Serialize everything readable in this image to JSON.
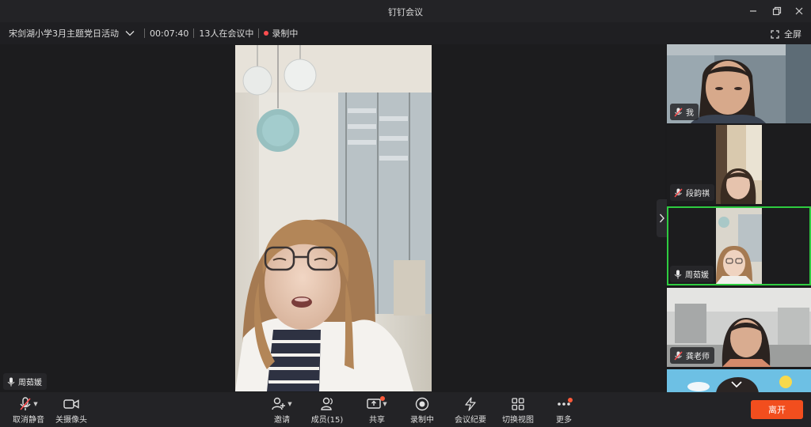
{
  "window": {
    "title": "钉钉会议"
  },
  "meeting": {
    "name": "宋剑湖小学3月主题党日活动",
    "duration": "00:07:40",
    "participants_status": "13人在会议中",
    "recording_status": "录制中",
    "fullscreen_label": "全屏"
  },
  "main_speaker": {
    "name": "周茹媛"
  },
  "participants": [
    {
      "name": "我"
    },
    {
      "name": "段韵祺"
    },
    {
      "name": "周茹媛"
    },
    {
      "name": "龚老师"
    },
    {
      "name": ""
    }
  ],
  "toolbar": {
    "unmute": "取消静音",
    "camera_off": "关摄像头",
    "invite": "邀请",
    "members": "成员(15)",
    "share": "共享",
    "record": "录制中",
    "minutes": "会议纪要",
    "switch_view": "切换视图",
    "more": "更多",
    "leave": "离开"
  },
  "colors": {
    "accent_red": "#ff4d4f",
    "leave_button": "#f24e1e",
    "active_speaker_border": "#2ecc40"
  }
}
